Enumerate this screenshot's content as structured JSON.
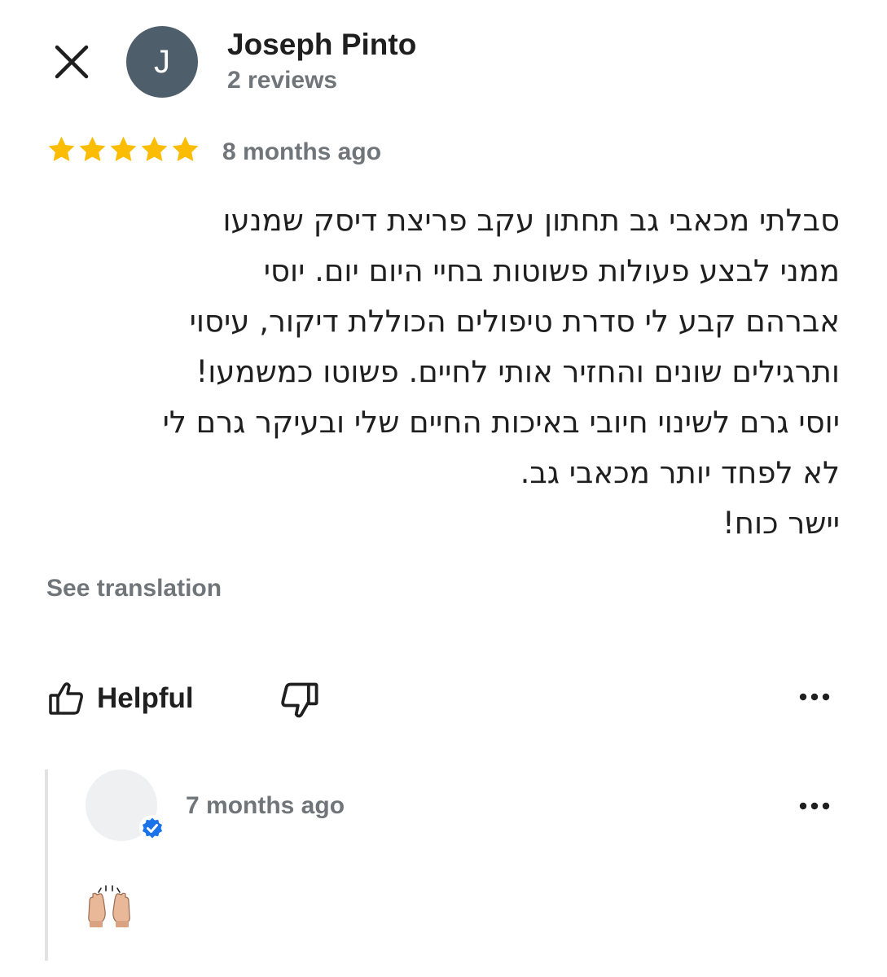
{
  "author": {
    "initial": "J",
    "name": "Joseph Pinto",
    "meta": "2 reviews",
    "avatar_color": "#4f5e6b"
  },
  "review": {
    "rating": 5,
    "star_color": "#fbbc04",
    "date": "8 months ago",
    "lines": [
      "סבלתי מכאבי גב תחתון עקב פריצת דיסק שמנעו",
      "ממני לבצע פעולות פשוטות בחיי היום יום. יוסי",
      "אברהם קבע לי סדרת טיפולים הכוללת דיקור, עיסוי",
      "ותרגילים שונים והחזיר אותי לחיים. פשוטו כמשמעו!",
      "יוסי גרם לשינוי חיובי באיכות החיים שלי ובעיקר גרם לי",
      "לא לפחד יותר מכאבי גב.",
      "יישר כוח!"
    ]
  },
  "actions": {
    "see_translation": "See translation",
    "helpful": "Helpful"
  },
  "owner_reply": {
    "date": "7 months ago",
    "content_icon": "raising-hands-emoji",
    "verified_color": "#1a73e8"
  },
  "icons": {
    "close": "close-icon",
    "thumbs_up": "thumbs-up-icon",
    "thumbs_down": "thumbs-down-icon",
    "more": "more-horizontal-icon",
    "verified": "verified-check-icon"
  }
}
